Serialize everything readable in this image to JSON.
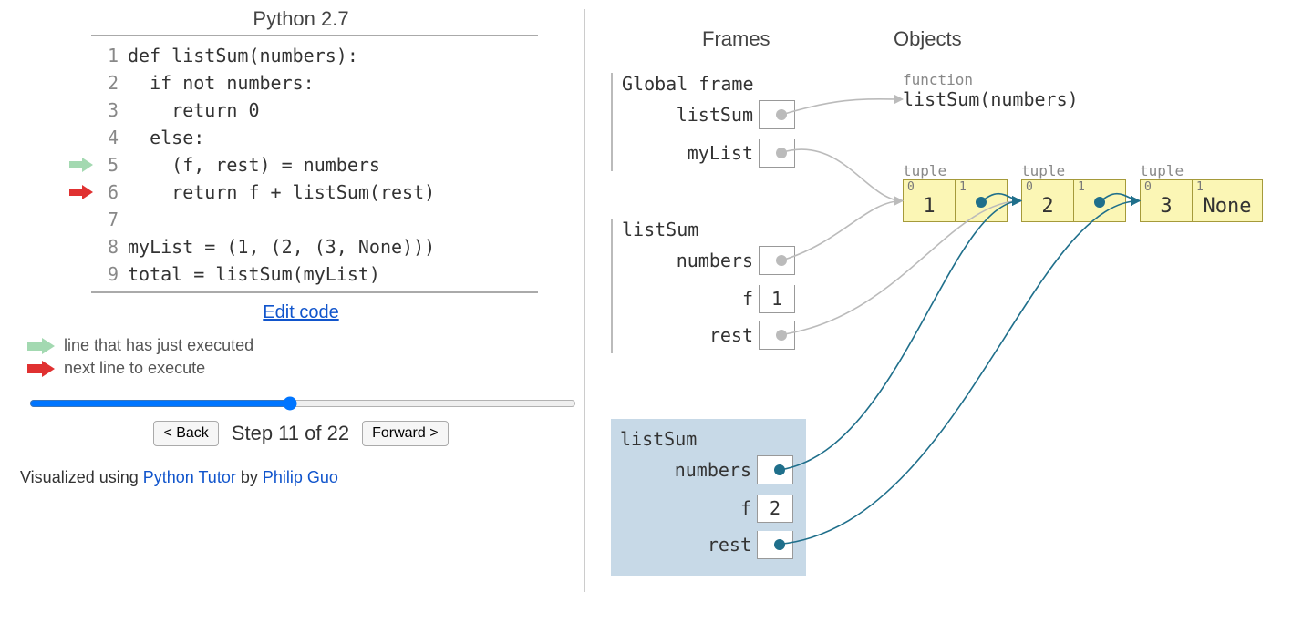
{
  "title": "Python 2.7",
  "code_lines": [
    {
      "n": 1,
      "text": "def listSum(numbers):",
      "prev": false,
      "next": false
    },
    {
      "n": 2,
      "text": "  if not numbers:",
      "prev": false,
      "next": false
    },
    {
      "n": 3,
      "text": "    return 0",
      "prev": false,
      "next": false
    },
    {
      "n": 4,
      "text": "  else:",
      "prev": false,
      "next": false
    },
    {
      "n": 5,
      "text": "    (f, rest) = numbers",
      "prev": true,
      "next": false
    },
    {
      "n": 6,
      "text": "    return f + listSum(rest)",
      "prev": false,
      "next": true
    },
    {
      "n": 7,
      "text": "",
      "prev": false,
      "next": false
    },
    {
      "n": 8,
      "text": "myList = (1, (2, (3, None)))",
      "prev": false,
      "next": false
    },
    {
      "n": 9,
      "text": "total = listSum(myList)",
      "prev": false,
      "next": false
    }
  ],
  "edit_link": "Edit code",
  "legend": {
    "prev": "line that has just executed",
    "next": "next line to execute"
  },
  "nav": {
    "back": "< Back",
    "forward": "Forward >",
    "step_prefix": "Step ",
    "step_cur": 11,
    "step_total": 22,
    "step_sep": " of "
  },
  "credit": {
    "prefix": "Visualized using ",
    "pt": "Python Tutor",
    "mid": " by ",
    "author": "Philip Guo"
  },
  "columns": {
    "frames": "Frames",
    "objects": "Objects"
  },
  "frames": {
    "global": {
      "name": "Global frame",
      "vars": [
        {
          "name": "listSum",
          "ptr": true
        },
        {
          "name": "myList",
          "ptr": true
        }
      ]
    },
    "f1": {
      "name": "listSum",
      "vars": [
        {
          "name": "numbers",
          "ptr": true
        },
        {
          "name": "f",
          "val": "1"
        },
        {
          "name": "rest",
          "ptr": true
        }
      ]
    },
    "f2": {
      "name": "listSum",
      "vars": [
        {
          "name": "numbers",
          "ptr": true
        },
        {
          "name": "f",
          "val": "2"
        },
        {
          "name": "rest",
          "ptr": true
        }
      ]
    }
  },
  "objects": {
    "func": {
      "label": "function",
      "text": "listSum(numbers)"
    },
    "tuples": [
      {
        "label": "tuple",
        "cells": [
          {
            "idx": "0",
            "val": "1"
          },
          {
            "idx": "1",
            "ptr": true
          }
        ]
      },
      {
        "label": "tuple",
        "cells": [
          {
            "idx": "0",
            "val": "2"
          },
          {
            "idx": "1",
            "ptr": true
          }
        ]
      },
      {
        "label": "tuple",
        "cells": [
          {
            "idx": "0",
            "val": "3"
          },
          {
            "idx": "1",
            "val": "None"
          }
        ]
      }
    ]
  }
}
